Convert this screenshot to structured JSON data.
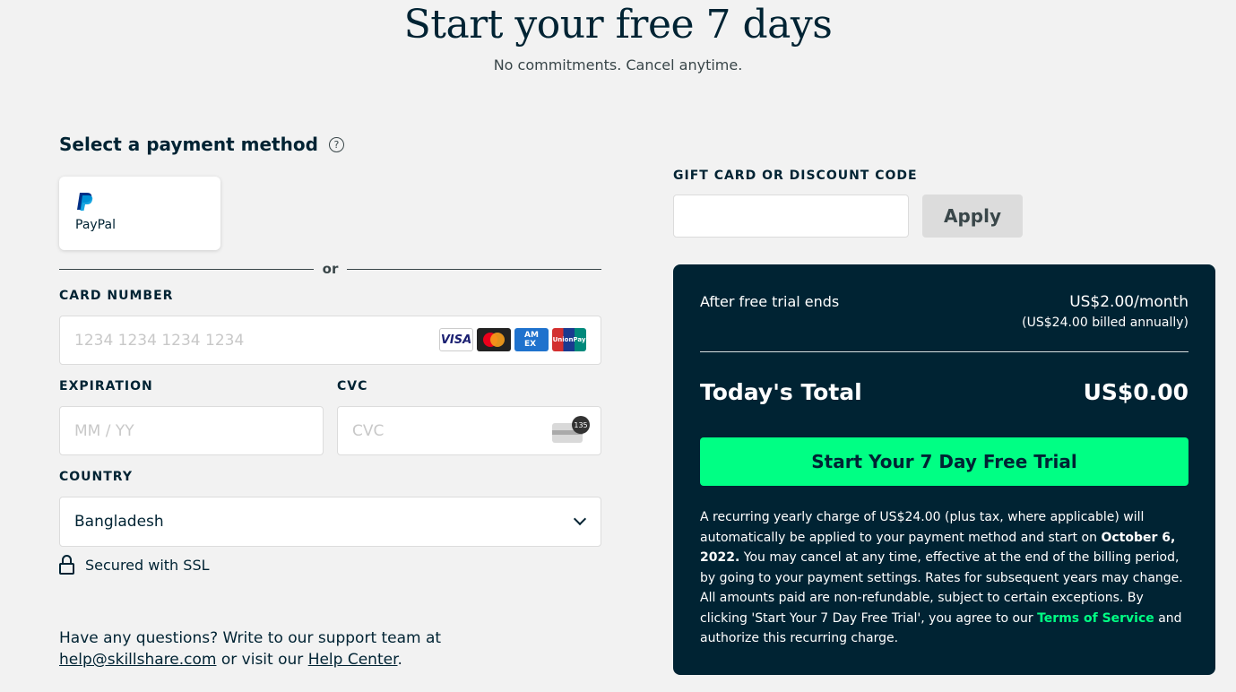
{
  "header": {
    "title": "Start your free 7 days",
    "subtitle": "No commitments. Cancel anytime."
  },
  "payment": {
    "section_title": "Select a payment method",
    "help_icon": "question-circle-icon",
    "paypal_label": "PayPal",
    "or_text": "or",
    "card_number_label": "CARD NUMBER",
    "card_number_placeholder": "1234 1234 1234 1234",
    "card_brands": [
      "VISA",
      "Mastercard",
      "AMEX",
      "UnionPay"
    ],
    "expiration_label": "EXPIRATION",
    "expiration_placeholder": "MM / YY",
    "cvc_label": "CVC",
    "cvc_placeholder": "CVC",
    "cvc_badge": "135",
    "country_label": "COUNTRY",
    "country_value": "Bangladesh",
    "ssl_text": "Secured with SSL"
  },
  "support": {
    "text_before": "Have any questions? Write to our support team at",
    "email": "help@skillshare.com",
    "text_mid": "or visit our",
    "help_center": "Help Center",
    "text_end": "."
  },
  "gift": {
    "label": "GIFT CARD OR DISCOUNT CODE",
    "value": "",
    "apply_label": "Apply"
  },
  "summary": {
    "after_trial_label": "After free trial ends",
    "price": "US$2.00/month",
    "billed": "(US$24.00 billed annually)",
    "total_label": "Today's Total",
    "total_value": "US$0.00",
    "cta_label": "Start Your 7 Day Free Trial",
    "legal_1": "A recurring yearly charge of US$24.00 (plus tax, where applicable) will automatically be applied to your payment method and start on ",
    "legal_date": "October 6, 2022.",
    "legal_2": " You may cancel at any time, effective at the end of the billing period, by going to your payment settings. Rates for subsequent years may change. All amounts paid are non-refundable, subject to certain exceptions. By clicking 'Start Your 7 Day Free Trial', you agree to our ",
    "legal_link": "Terms of Service",
    "legal_3": " and authorize this recurring charge."
  },
  "colors": {
    "background": "#f2f2f2",
    "navy": "#002333",
    "accent_green": "#00ff84"
  }
}
